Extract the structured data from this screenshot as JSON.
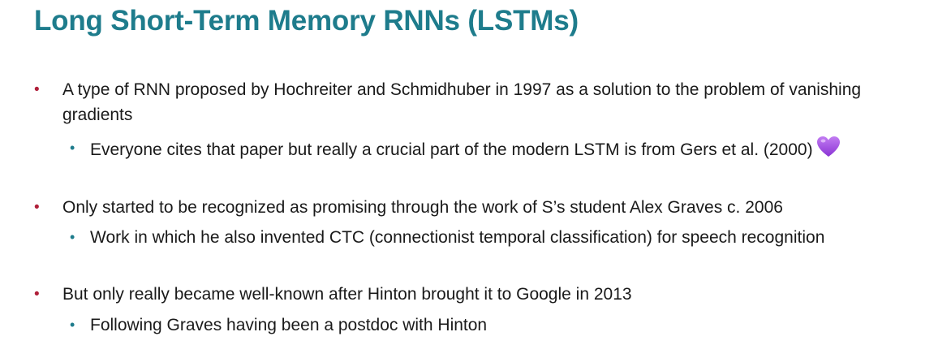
{
  "slide": {
    "title": "Long Short-Term Memory RNNs (LSTMs)",
    "bullets": [
      {
        "text": "A type of RNN proposed by Hochreiter and Schmidhuber in 1997 as a solution to the problem of vanishing gradients",
        "sub": "Everyone cites that paper but really a crucial part of the modern LSTM is from Gers et al. (2000)",
        "sub_icon": "purple-heart-icon"
      },
      {
        "text": "Only started to be recognized as promising through the work of S’s student Alex Graves c. 2006",
        "sub": "Work in which he also invented CTC (connectionist temporal classification) for speech recognition"
      },
      {
        "text": "But only really became well-known after Hinton brought it to Google in 2013",
        "sub": "Following Graves having been a postdoc with Hinton"
      }
    ],
    "colors": {
      "title": "#1e7c8c",
      "bullet_level1": "#b0203a",
      "bullet_level2": "#1e7c8c",
      "heart": "#a24ee0"
    }
  }
}
